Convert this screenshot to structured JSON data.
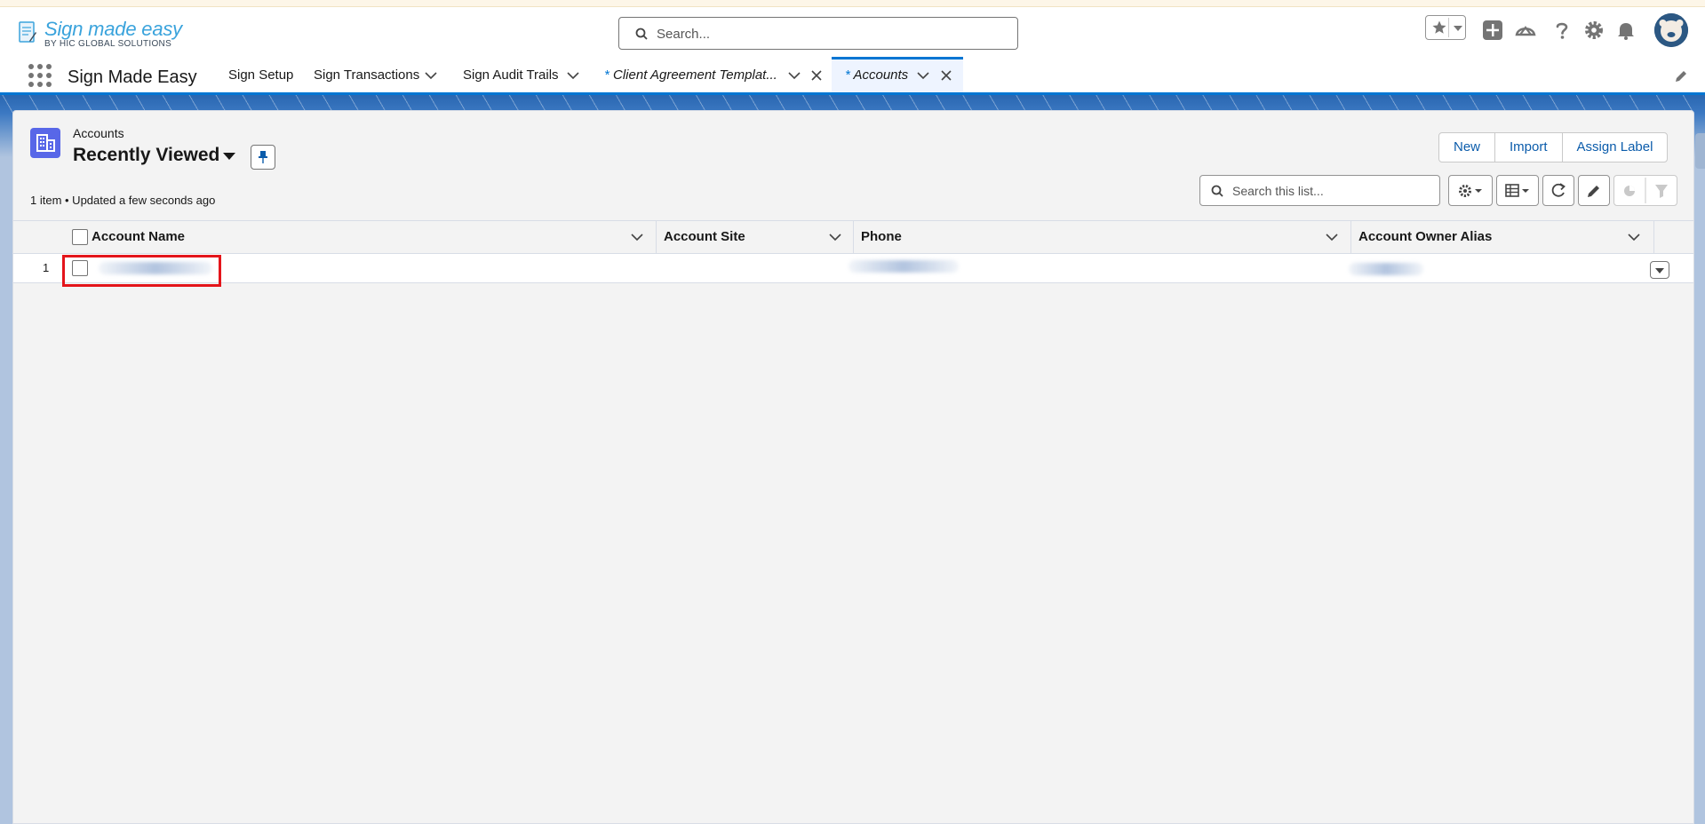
{
  "header": {
    "brand_main": "Sign made easy",
    "brand_sub": "BY HIC GLOBAL SOLUTIONS",
    "search_placeholder": "Search..."
  },
  "appnav": {
    "app_name": "Sign Made Easy",
    "items": [
      {
        "label": "Sign Setup",
        "has_dropdown": false
      },
      {
        "label": "Sign Transactions",
        "has_dropdown": true
      },
      {
        "label": "Sign Audit Trails",
        "has_dropdown": true
      }
    ],
    "tabs": [
      {
        "prefix": "*",
        "label": "Client Agreement Templat...",
        "active": false
      },
      {
        "prefix": "*",
        "label": "Accounts",
        "active": true
      }
    ]
  },
  "listview": {
    "object_label": "Accounts",
    "list_name": "Recently Viewed",
    "meta": "1 item • Updated a few seconds ago",
    "buttons": [
      "New",
      "Import",
      "Assign Label"
    ],
    "search_placeholder": "Search this list...",
    "columns": [
      "Account Name",
      "Account Site",
      "Phone",
      "Account Owner Alias"
    ],
    "rows": [
      {
        "num": "1",
        "account_name": "",
        "account_site": "",
        "phone": "",
        "owner_alias": ""
      }
    ]
  },
  "colors": {
    "accent": "#0176d3",
    "highlight": "#e4151b",
    "object_icon": "#5867e8"
  }
}
